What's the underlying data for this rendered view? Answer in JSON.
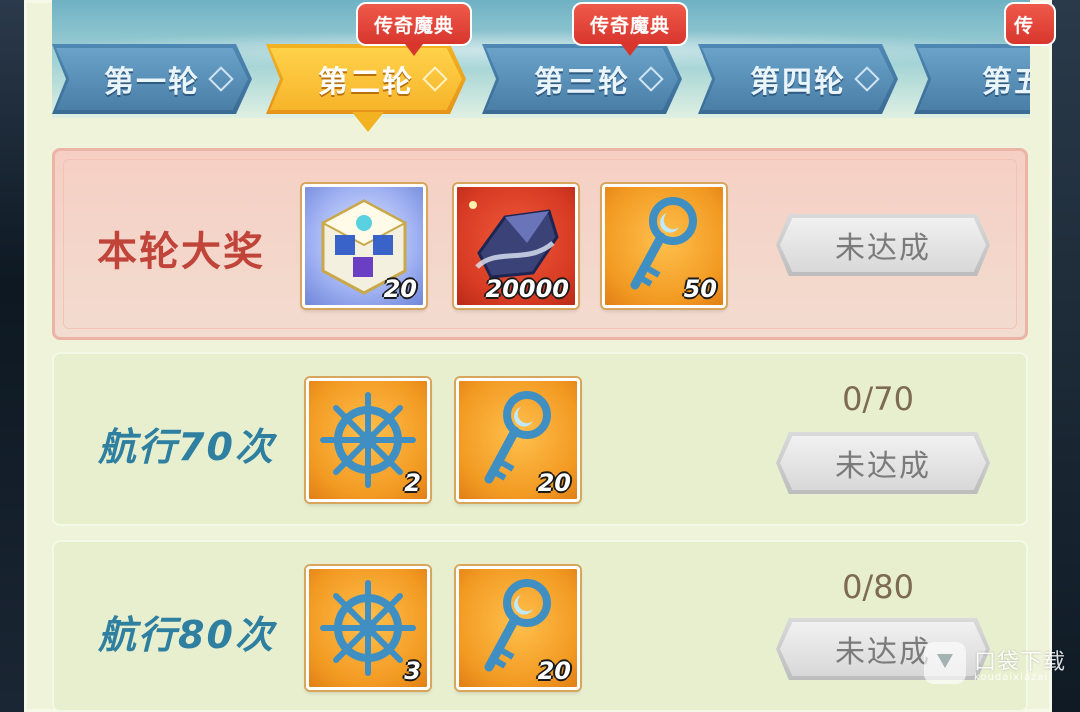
{
  "tabs": [
    {
      "label": "第一轮",
      "active": false
    },
    {
      "label": "第二轮",
      "active": true
    },
    {
      "label": "第三轮",
      "active": false
    },
    {
      "label": "第四轮",
      "active": false
    },
    {
      "label": "第五",
      "active": false
    }
  ],
  "badges": [
    "传奇魔典",
    "传奇魔典",
    "传"
  ],
  "rows": [
    {
      "title": "本轮大奖",
      "items": [
        {
          "icon": "crystal-cube-icon",
          "qty": "20"
        },
        {
          "icon": "dark-crystal-shard-icon",
          "qty": "20000"
        },
        {
          "icon": "moon-key-icon",
          "qty": "50"
        }
      ],
      "progress": "",
      "button": "未达成"
    },
    {
      "title": "航行70次",
      "items": [
        {
          "icon": "ship-wheel-icon",
          "qty": "2"
        },
        {
          "icon": "moon-key-icon",
          "qty": "20"
        }
      ],
      "progress": "0/70",
      "button": "未达成"
    },
    {
      "title": "航行80次",
      "items": [
        {
          "icon": "ship-wheel-icon",
          "qty": "3"
        },
        {
          "icon": "moon-key-icon",
          "qty": "20"
        }
      ],
      "progress": "0/80",
      "button": "未达成"
    }
  ],
  "watermark": {
    "text": "口袋下载",
    "sub": "koudaixiazai"
  },
  "colors": {
    "tab_active": "#f6b42a",
    "tab_inactive": "#4a7fa8",
    "grand_title": "#c1443b",
    "row_title": "#2e7fa0",
    "badge": "#d8362d"
  }
}
